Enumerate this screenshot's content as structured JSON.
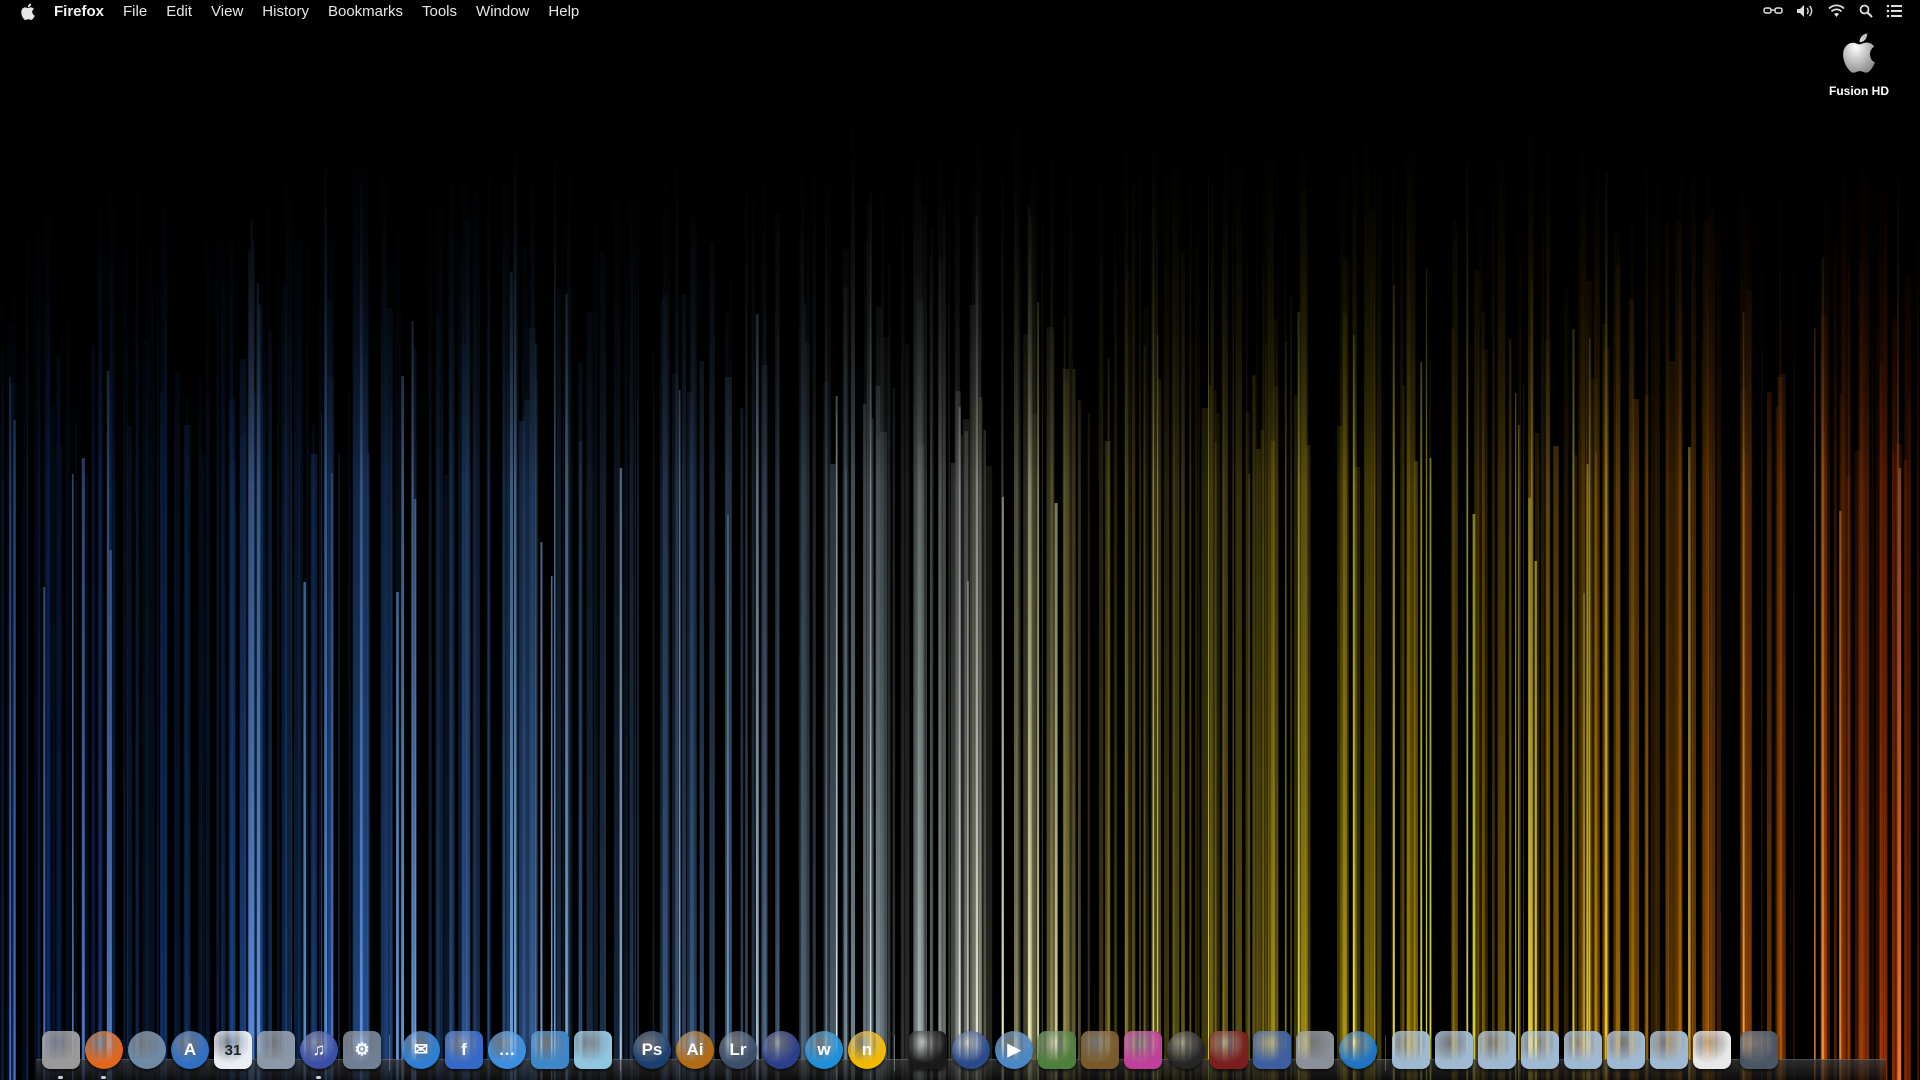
{
  "menubar": {
    "app_name": "Firefox",
    "menus": [
      "File",
      "Edit",
      "View",
      "History",
      "Bookmarks",
      "Tools",
      "Window",
      "Help"
    ],
    "status_icons": [
      "glasses-icon",
      "volume-icon",
      "wifi-icon",
      "spotlight-icon",
      "notification-list-icon"
    ]
  },
  "desktop": {
    "drive_label": "Fusion HD"
  },
  "dock": {
    "items": [
      {
        "name": "finder-mask",
        "icon": "mask-icon",
        "color": "#9a9a9a",
        "glyph": ""
      },
      {
        "name": "firefox",
        "icon": "firefox-icon",
        "color": "#e2661c",
        "glyph": ""
      },
      {
        "name": "network-radar",
        "icon": "globe-icon",
        "color": "#6d8aa6",
        "glyph": ""
      },
      {
        "name": "app-store",
        "icon": "app-store-icon",
        "color": "#2f6fc4",
        "glyph": "A"
      },
      {
        "name": "calendar",
        "icon": "calendar-icon",
        "color": "#e9eef4",
        "glyph": "31"
      },
      {
        "name": "launchpad",
        "icon": "rocket-icon",
        "color": "#8a98a8",
        "glyph": ""
      },
      {
        "name": "itunes",
        "icon": "music-note-icon",
        "color": "#3b4fa8",
        "glyph": "♫"
      },
      {
        "name": "system-preferences",
        "icon": "gear-icon",
        "color": "#6f7f94",
        "glyph": "⚙"
      },
      {
        "name": "mail",
        "icon": "mail-icon",
        "color": "#2d7fd6",
        "glyph": "✉"
      },
      {
        "name": "facebook",
        "icon": "facebook-icon",
        "color": "#3468c9",
        "glyph": "f"
      },
      {
        "name": "messages",
        "icon": "speech-bubble-icon",
        "color": "#3c8ee0",
        "glyph": "…"
      },
      {
        "name": "photo-booth",
        "icon": "user-icon",
        "color": "#3d86c8",
        "glyph": ""
      },
      {
        "name": "preview",
        "icon": "document-icon",
        "color": "#8fc7e0",
        "glyph": ""
      },
      {
        "name": "photoshop",
        "icon": "photoshop-icon",
        "color": "#1b3f6e",
        "glyph": "Ps"
      },
      {
        "name": "illustrator",
        "icon": "illustrator-icon",
        "color": "#b36a12",
        "glyph": "Ai"
      },
      {
        "name": "lightroom",
        "icon": "lightroom-icon",
        "color": "#3a4f6a",
        "glyph": "Lr"
      },
      {
        "name": "cinema-4d",
        "icon": "cinema4d-icon",
        "color": "#2b3e8a",
        "glyph": ""
      },
      {
        "name": "wunderlist",
        "icon": "w-icon",
        "color": "#1f8fd8",
        "glyph": "w"
      },
      {
        "name": "notes",
        "icon": "n-icon",
        "color": "#f3b800",
        "glyph": "n"
      },
      {
        "name": "windows-vm",
        "icon": "windows-logo-icon",
        "color": "#1a1a1a",
        "glyph": ""
      },
      {
        "name": "dashboard",
        "icon": "compass-icon",
        "color": "#2b4a8c",
        "glyph": ""
      },
      {
        "name": "quicktime",
        "icon": "play-icon",
        "color": "#4a87c6",
        "glyph": "▶"
      },
      {
        "name": "xbmc",
        "icon": "xbmc-icon",
        "color": "#4f7f3c",
        "glyph": ""
      },
      {
        "name": "iphoto",
        "icon": "photos-icon",
        "color": "#7a5a2a",
        "glyph": ""
      },
      {
        "name": "imac-utility",
        "icon": "monitor-icon",
        "color": "#c03f9a",
        "glyph": ""
      },
      {
        "name": "aperture",
        "icon": "lens-icon",
        "color": "#262626",
        "glyph": ""
      },
      {
        "name": "photo-grid",
        "icon": "grid-icon",
        "color": "#7a1e1e",
        "glyph": ""
      },
      {
        "name": "imovie",
        "icon": "clapper-icon",
        "color": "#3d5fa0",
        "glyph": ""
      },
      {
        "name": "disk-utility",
        "icon": "disk-icon",
        "color": "#8a8f99",
        "glyph": ""
      },
      {
        "name": "teamviewer",
        "icon": "teamviewer-icon",
        "color": "#1f74c4",
        "glyph": ""
      },
      {
        "name": "applications-folder",
        "icon": "folder-apps-icon",
        "color": "#9fb9d2",
        "glyph": ""
      },
      {
        "name": "documents-folder",
        "icon": "folder-documents-icon",
        "color": "#9fb9d2",
        "glyph": ""
      },
      {
        "name": "pictures-folder",
        "icon": "folder-pictures-icon",
        "color": "#9fb9d2",
        "glyph": ""
      },
      {
        "name": "movies-folder",
        "icon": "folder-movies-icon",
        "color": "#9fb9d2",
        "glyph": ""
      },
      {
        "name": "music-folder",
        "icon": "folder-music-icon",
        "color": "#9fb9d2",
        "glyph": ""
      },
      {
        "name": "shared-folder",
        "icon": "folder-shared-icon",
        "color": "#9fb9d2",
        "glyph": ""
      },
      {
        "name": "downloads-folder",
        "icon": "folder-downloads-icon",
        "color": "#9fb9d2",
        "glyph": ""
      },
      {
        "name": "downloads-stack",
        "icon": "stack-icon",
        "color": "#e8e8e8",
        "glyph": ""
      },
      {
        "name": "trash",
        "icon": "trash-icon",
        "color": "#4a5566",
        "glyph": ""
      }
    ]
  }
}
